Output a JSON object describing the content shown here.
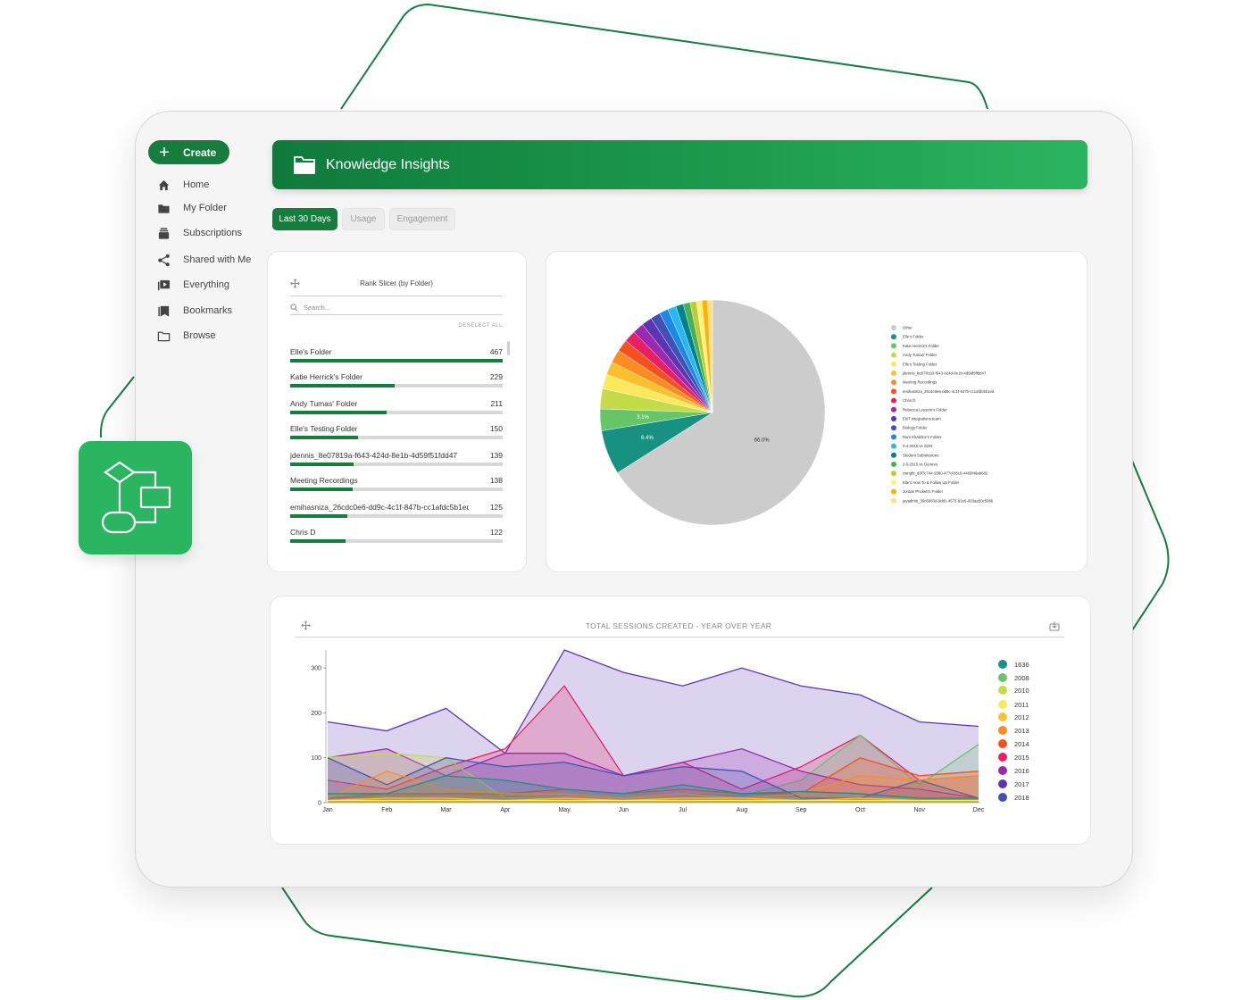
{
  "sidebar": {
    "create_label": "Create",
    "items": [
      {
        "label": "Home",
        "icon": "home-icon"
      },
      {
        "label": "My Folder",
        "icon": "folder-icon"
      },
      {
        "label": "Subscriptions",
        "icon": "subscriptions-icon"
      },
      {
        "label": "Shared with Me",
        "icon": "share-icon"
      },
      {
        "label": "Everything",
        "icon": "play-library-icon"
      },
      {
        "label": "Bookmarks",
        "icon": "bookmark-icon"
      },
      {
        "label": "Browse",
        "icon": "browse-folder-icon"
      }
    ]
  },
  "header": {
    "title": "Knowledge Insights",
    "icon": "folder-icon"
  },
  "tabs": [
    {
      "label": "Last 30 Days",
      "active": true
    },
    {
      "label": "Usage",
      "active": false
    },
    {
      "label": "Engagement",
      "active": false
    }
  ],
  "rank_slicer": {
    "title": "Rank Slicer (by Folder)",
    "search_placeholder": "Search...",
    "deselect_label": "DESELECT ALL",
    "rows": [
      {
        "label": "Elle's Folder",
        "value": 467
      },
      {
        "label": "Katie Herrick's Folder",
        "value": 229
      },
      {
        "label": "Andy Tumas' Folder",
        "value": 211
      },
      {
        "label": "Elle's Testing Folder",
        "value": 150
      },
      {
        "label": "jdennis_8e07819a-f643-424d-8e1b-4d59f51fdd47",
        "value": 139
      },
      {
        "label": "Meeting Recordings",
        "value": 138
      },
      {
        "label": "emihasniza_26cdc0e6-dd9c-4c1f-847b-cc1afdc5b1ed",
        "value": 125
      },
      {
        "label": "Chris D",
        "value": 122
      }
    ]
  },
  "chart_data": [
    {
      "type": "pie",
      "slices": [
        {
          "name": "Other",
          "value": 66.0,
          "color": "#cccccc",
          "label": "66.0%"
        },
        {
          "name": "Elle's Folder",
          "value": 6.4,
          "color": "#179282",
          "label": "6.4%"
        },
        {
          "name": "Katie Herrick's Folder",
          "value": 3.1,
          "color": "#66c667",
          "label": "3.1%"
        },
        {
          "name": "Andy Tumas' Folder",
          "value": 2.9,
          "color": "#c5dc48",
          "label": ""
        },
        {
          "name": "Elle's Testing Folder",
          "value": 2.1,
          "color": "#fbe95b",
          "label": ""
        },
        {
          "name": "jdennis_be078193-f643-424d-8e1b-4d59f5ffdd47",
          "value": 1.9,
          "color": "#fbc02d",
          "label": ""
        },
        {
          "name": "Meeting Recordings",
          "value": 1.9,
          "color": "#fb8c23",
          "label": ""
        },
        {
          "name": "emihasniza_26cdc0e6-dd9c-4c1f-847b-cc1afdc5b1ed",
          "value": 1.7,
          "color": "#f4511e",
          "label": ""
        },
        {
          "name": "Chris D",
          "value": 1.7,
          "color": "#e91e63",
          "label": ""
        },
        {
          "name": "Rebecca Lessem's Folder",
          "value": 1.6,
          "color": "#9c27b0",
          "label": ""
        },
        {
          "name": "ENT integrations team",
          "value": 1.5,
          "color": "#5e35b1",
          "label": ""
        },
        {
          "name": "Biology Folder",
          "value": 1.4,
          "color": "#3f51b5",
          "label": ""
        },
        {
          "name": "Rani Khaikhor's Folder",
          "value": 1.3,
          "color": "#1e88e5",
          "label": ""
        },
        {
          "name": "3-4-2015 vs SON",
          "value": 1.2,
          "color": "#29b6f6",
          "label": ""
        },
        {
          "name": "Student Submissions",
          "value": 1.1,
          "color": "#00838f",
          "label": ""
        },
        {
          "name": "2-5-2015 vs Geneva",
          "value": 1.0,
          "color": "#4caf50",
          "label": ""
        },
        {
          "name": "cwright_d3f7c744-9380-477d-b5c9-4469f49ab682",
          "value": 0.9,
          "color": "#c0ca33",
          "label": ""
        },
        {
          "name": "Elle's How To & Follow Up Folder",
          "value": 0.8,
          "color": "#fff176",
          "label": ""
        },
        {
          "name": "Jordan Prickett's Folder",
          "value": 0.8,
          "color": "#ffb300",
          "label": ""
        },
        {
          "name": "jayadmin_39c6083d-9dd1-4573-92e6-003aa50c5066",
          "value": 0.7,
          "color": "#ffe082",
          "label": ""
        }
      ]
    },
    {
      "type": "area",
      "title": "TOTAL SESSIONS CREATED - YEAR OVER YEAR",
      "categories": [
        "Jan",
        "Feb",
        "Mar",
        "Apr",
        "May",
        "Jun",
        "Jul",
        "Aug",
        "Sep",
        "Oct",
        "Nov",
        "Dec"
      ],
      "ylim": [
        0,
        340
      ],
      "yticks": [
        0,
        100,
        200,
        300
      ],
      "series": [
        {
          "name": "1636",
          "color": "#179282",
          "values": [
            20,
            20,
            60,
            50,
            30,
            20,
            40,
            20,
            25,
            20,
            10,
            10
          ]
        },
        {
          "name": "2008",
          "color": "#66c667",
          "values": [
            10,
            15,
            20,
            15,
            10,
            10,
            20,
            15,
            50,
            150,
            40,
            130
          ]
        },
        {
          "name": "2010",
          "color": "#c5dc48",
          "values": [
            100,
            110,
            100,
            10,
            10,
            10,
            10,
            10,
            10,
            10,
            10,
            10
          ]
        },
        {
          "name": "2011",
          "color": "#fbe95b",
          "values": [
            5,
            5,
            5,
            5,
            5,
            5,
            5,
            5,
            5,
            5,
            5,
            5
          ]
        },
        {
          "name": "2012",
          "color": "#fbc02d",
          "values": [
            5,
            10,
            10,
            5,
            10,
            5,
            10,
            10,
            5,
            10,
            5,
            5
          ]
        },
        {
          "name": "2013",
          "color": "#fb8c23",
          "values": [
            10,
            70,
            30,
            20,
            20,
            10,
            20,
            10,
            20,
            60,
            50,
            60
          ]
        },
        {
          "name": "2014",
          "color": "#f4511e",
          "values": [
            10,
            20,
            20,
            20,
            30,
            20,
            30,
            20,
            20,
            100,
            60,
            70
          ]
        },
        {
          "name": "2015",
          "color": "#e91e63",
          "values": [
            50,
            30,
            80,
            120,
            260,
            60,
            90,
            30,
            80,
            150,
            50,
            60
          ]
        },
        {
          "name": "2016",
          "color": "#9c27b0",
          "values": [
            100,
            120,
            60,
            110,
            110,
            60,
            90,
            120,
            70,
            40,
            30,
            10
          ]
        },
        {
          "name": "2017",
          "color": "#5e35b1",
          "values": [
            180,
            160,
            210,
            110,
            340,
            290,
            260,
            300,
            260,
            240,
            180,
            170
          ]
        },
        {
          "name": "2018",
          "color": "#3f51b5",
          "values": [
            100,
            40,
            100,
            80,
            90,
            60,
            80,
            70,
            10,
            10,
            50,
            10
          ]
        }
      ]
    }
  ]
}
